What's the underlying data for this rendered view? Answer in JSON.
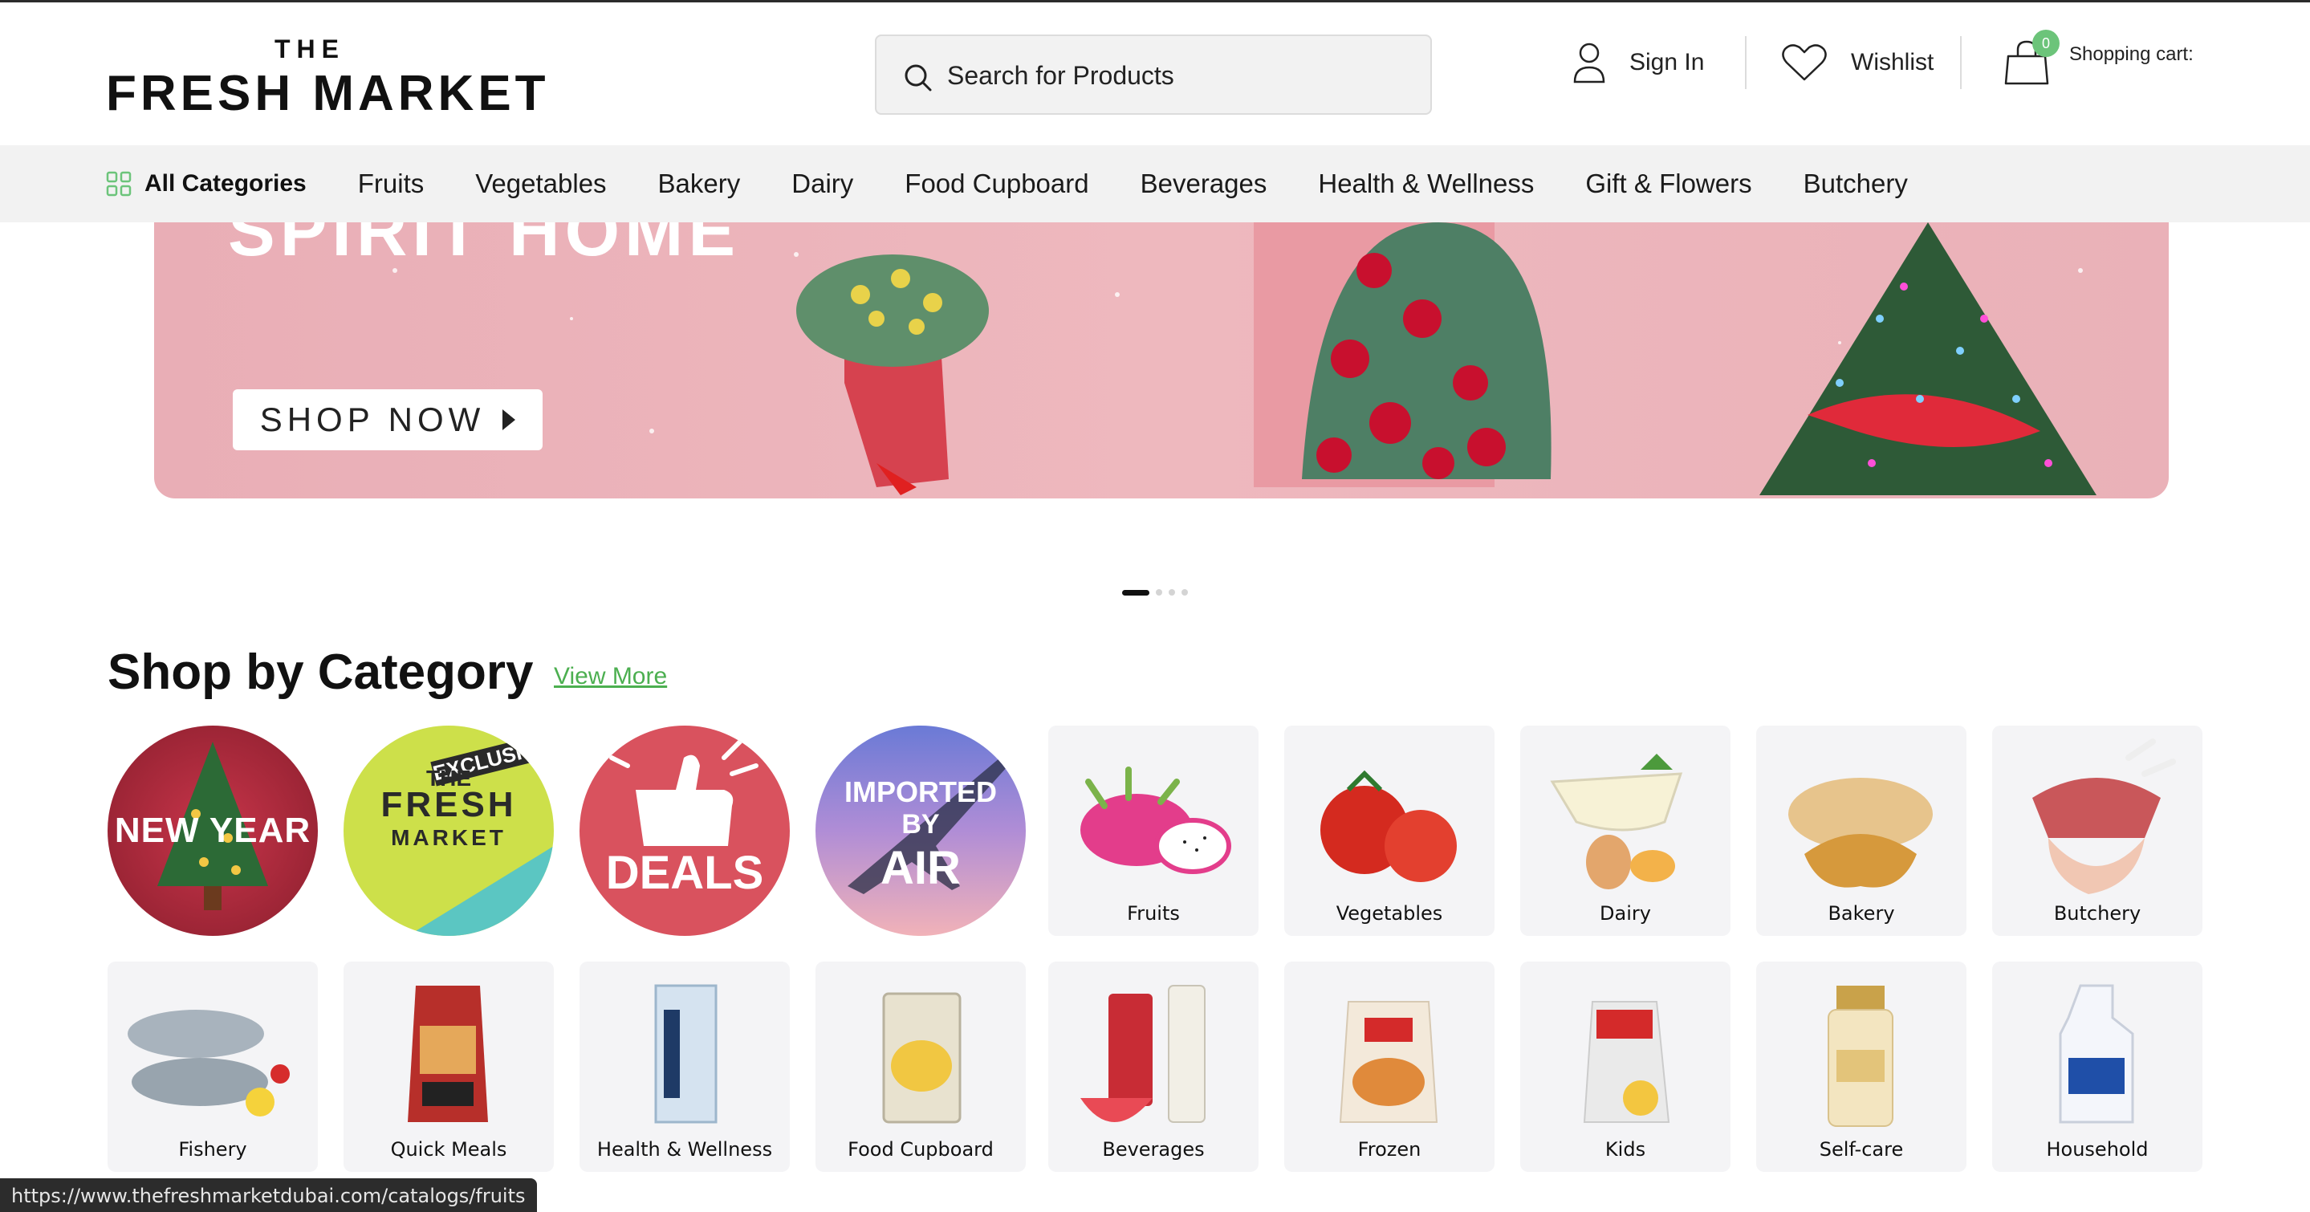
{
  "header": {
    "logo_top": "THE",
    "logo_main": "FRESH MARKET",
    "search_placeholder": "Search for Products",
    "signin_label": "Sign In",
    "wishlist_label": "Wishlist",
    "cart_label": "Shopping cart:",
    "cart_count": "0"
  },
  "nav": {
    "all_categories": "All Categories",
    "items": [
      "Fruits",
      "Vegetables",
      "Bakery",
      "Dairy",
      "Food Cupboard",
      "Beverages",
      "Health & Wellness",
      "Gift & Flowers",
      "Butchery"
    ]
  },
  "banner": {
    "headline": "SPIRIT HOME",
    "cta": "SHOP NOW"
  },
  "category": {
    "title": "Shop by Category",
    "view_more": "View More",
    "circles": {
      "new_year": "NEW YEAR",
      "exclusive": "EXCLUSIVE",
      "exclusive_line1": "THE",
      "exclusive_line2": "FRESH",
      "exclusive_line3": "MARKET",
      "deals": "DEALS",
      "imported1": "IMPORTED",
      "imported2": "BY",
      "imported3": "AIR"
    },
    "row1": [
      "Fruits",
      "Vegetables",
      "Dairy",
      "Bakery",
      "Butchery"
    ],
    "row2": [
      "Fishery",
      "Quick Meals",
      "Health & Wellness",
      "Food Cupboard",
      "Beverages",
      "Frozen",
      "Kids",
      "Self-care",
      "Household"
    ]
  },
  "status_url": "https://www.thefreshmarketdubai.com/catalogs/fruits",
  "colors": {
    "accent_green": "#4caf50",
    "badge_green": "#6cc47a",
    "banner_pink": "#eeb8be"
  }
}
